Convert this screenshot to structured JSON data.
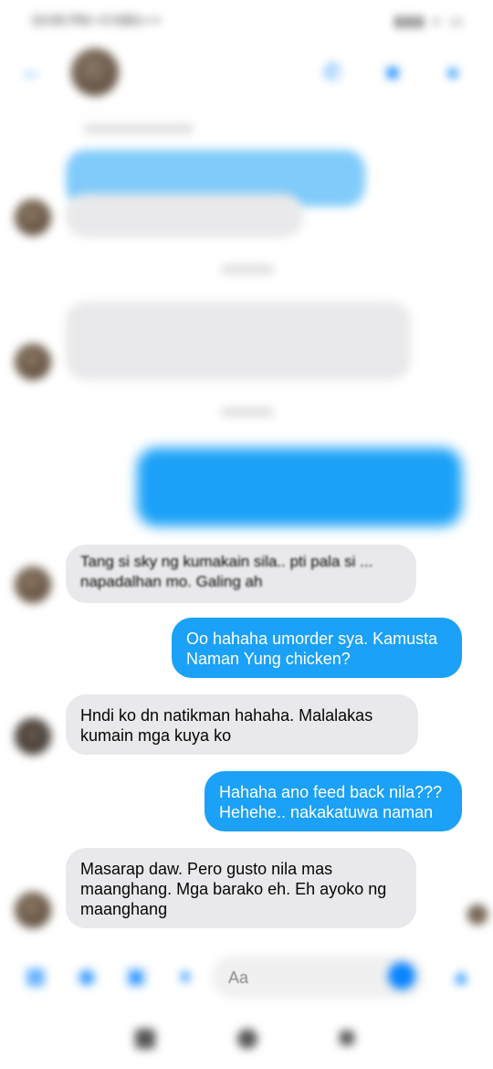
{
  "header": {
    "name": "",
    "status": ""
  },
  "composer": {
    "placeholder": "Aa"
  },
  "messages": [
    {
      "id": "m1",
      "direction": "incoming",
      "text": "Tang si sky ng kumakain sila.. pti pala si ... napadalhan mo. Galing ah"
    },
    {
      "id": "m2",
      "direction": "outgoing",
      "text": "Oo hahaha umorder sya. Kamusta Naman Yung chicken?"
    },
    {
      "id": "m3",
      "direction": "incoming",
      "text": "Hndi ko dn natikman hahaha. Malalakas kumain mga kuya ko"
    },
    {
      "id": "m4",
      "direction": "outgoing",
      "text": "Hahaha ano feed back nila??? Hehehe.. nakakatuwa naman"
    },
    {
      "id": "m5",
      "direction": "incoming",
      "text": "Masarap daw. Pero gusto nila mas maanghang. Mga barako eh. Eh ayoko ng maanghang"
    }
  ],
  "icons": {
    "back": "back-arrow-icon",
    "call": "phone-icon",
    "video": "video-camera-icon",
    "info": "info-icon",
    "menu": "grid-menu-icon",
    "camera": "camera-icon",
    "gallery": "image-icon",
    "mic": "microphone-icon",
    "emoji": "emoji-icon",
    "like": "thumbs-up-icon"
  },
  "colors": {
    "accent": "#0a84ff",
    "outgoing_bubble": "#1ba1f7",
    "incoming_bubble": "#e9e9eb"
  }
}
